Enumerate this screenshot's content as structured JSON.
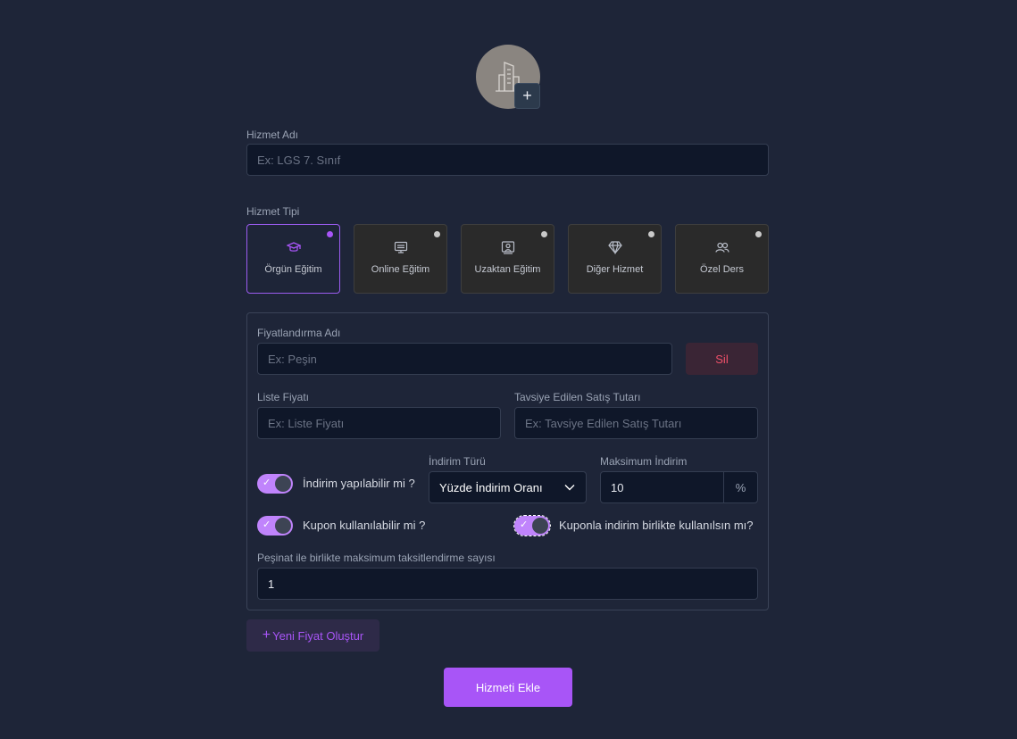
{
  "avatar": {
    "add_label": "+"
  },
  "service_name": {
    "label": "Hizmet Adı",
    "placeholder": "Ex: LGS 7. Sınıf"
  },
  "service_type": {
    "label": "Hizmet Tipi",
    "options": [
      {
        "label": "Örgün Eğitim",
        "icon": "graduation-cap-icon",
        "selected": true
      },
      {
        "label": "Online Eğitim",
        "icon": "monitor-icon",
        "selected": false
      },
      {
        "label": "Uzaktan Eğitim",
        "icon": "remote-classroom-icon",
        "selected": false
      },
      {
        "label": "Diğer Hizmet",
        "icon": "diamond-icon",
        "selected": false
      },
      {
        "label": "Özel Ders",
        "icon": "users-icon",
        "selected": false
      }
    ]
  },
  "pricing": {
    "name_label": "Fiyatlandırma Adı",
    "name_placeholder": "Ex: Peşin",
    "delete_label": "Sil",
    "list_price_label": "Liste Fiyatı",
    "list_price_placeholder": "Ex: Liste Fiyatı",
    "recommended_label": "Tavsiye Edilen Satış Tutarı",
    "recommended_placeholder": "Ex: Tavsiye Edilen Satış Tutarı",
    "discount_toggle_label": "İndirim yapılabilir mi ?",
    "discount_type_label": "İndirim Türü",
    "discount_type_value": "Yüzde İndirim Oranı",
    "max_discount_label": "Maksimum İndirim",
    "max_discount_value": "10",
    "max_discount_suffix": "%",
    "coupon_toggle_label": "Kupon kullanılabilir mi ?",
    "coupon_combo_label": "Kuponla indirim birlikte kullanılsın mı?",
    "installment_label": "Peşinat ile birlikte maksimum taksitlendirme sayısı",
    "installment_value": "1",
    "toggles": {
      "discount": true,
      "coupon": true,
      "coupon_combo": true
    }
  },
  "actions": {
    "new_price_label": "Yeni Fiyat Oluştur",
    "new_price_icon": "+",
    "submit_label": "Hizmeti Ekle"
  },
  "colors": {
    "accent": "#a855f7",
    "background": "#1e2538",
    "danger": "#f0506a"
  }
}
